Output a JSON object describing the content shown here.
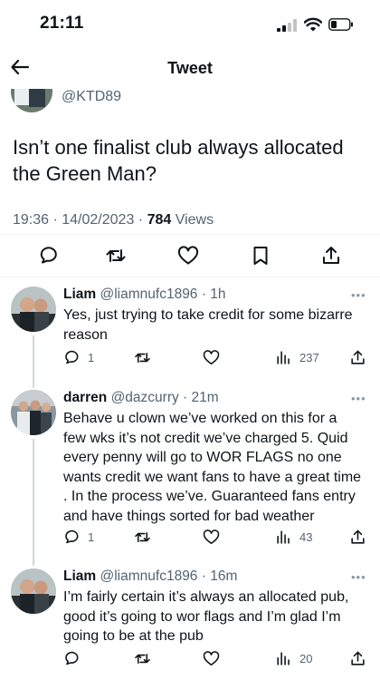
{
  "status_bar": {
    "time": "21:11"
  },
  "nav": {
    "title": "Tweet"
  },
  "tweet": {
    "handle": "@KTD89",
    "text": "Isn’t one finalist club always allocated the Green Man?",
    "time": "19:36 · 14/02/2023 · ",
    "views_count": "784",
    "views_label": " Views"
  },
  "replies": [
    {
      "name": "Liam",
      "handle": "@liamnufc1896 · 1h",
      "text": "Yes, just trying to take credit for some bizarre reason",
      "reply_count": "1",
      "retweet_count": "",
      "like_count": "",
      "views_count": "237"
    },
    {
      "name": "darren",
      "handle": "@dazcurry · 21m",
      "text": "Behave u clown we’ve worked on this for a few wks it’s not credit we’ve charged 5. Quid every penny will go to WOR FLAGS no one wants credit we want fans to have a great time . In the process we’ve. Guaranteed fans entry and have things sorted for bad weather",
      "reply_count": "1",
      "retweet_count": "",
      "like_count": "",
      "views_count": "43"
    },
    {
      "name": "Liam",
      "handle": "@liamnufc1896 · 16m",
      "text": "I’m fairly certain it’s always an allocated pub, good it’s going to wor flags and I’m glad I’m going to be at the pub",
      "reply_count": "",
      "retweet_count": "",
      "like_count": "",
      "views_count": "20"
    }
  ],
  "icons": {
    "back": "back-arrow-icon",
    "reply": "reply-icon",
    "retweet": "retweet-icon",
    "like": "like-icon",
    "bookmark": "bookmark-icon",
    "share": "share-icon",
    "views": "views-icon",
    "more": "more-icon"
  },
  "colors": {
    "text": "#0f1419",
    "secondary": "#536471",
    "divider": "#eff3f4"
  }
}
